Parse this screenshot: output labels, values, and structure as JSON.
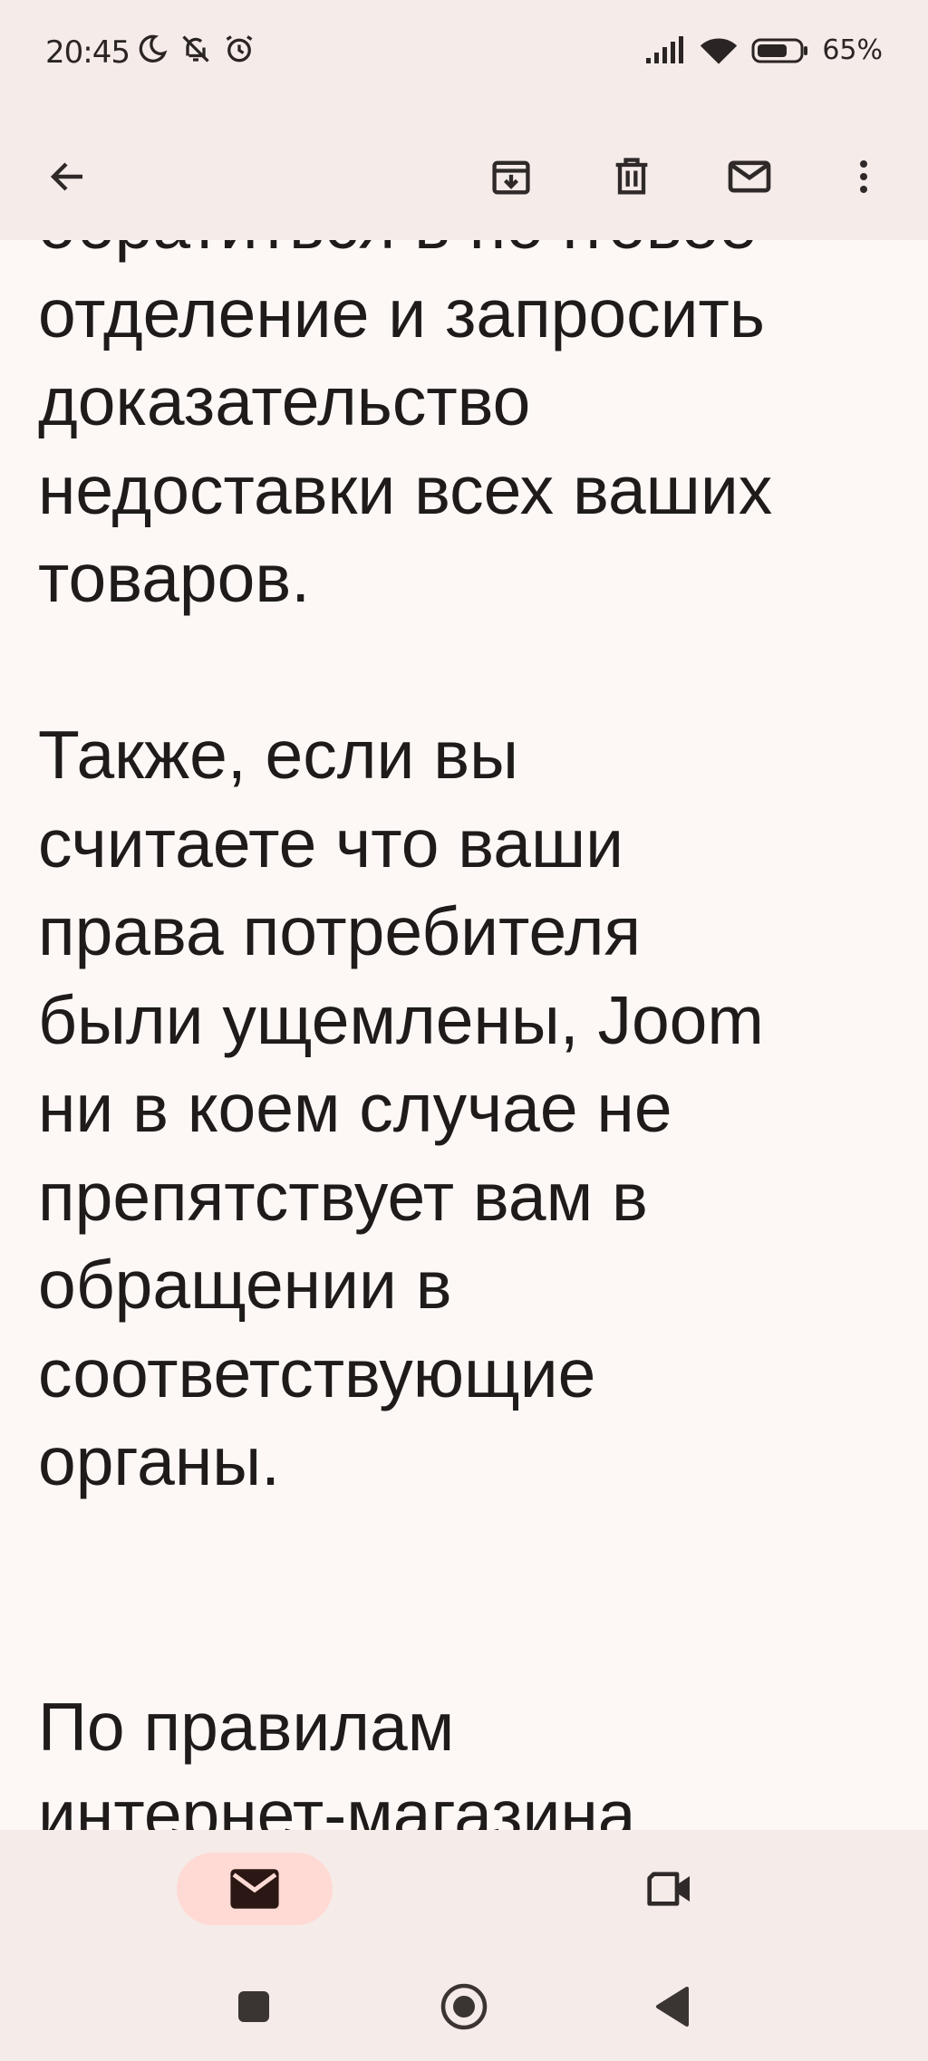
{
  "status_bar": {
    "time": "20:45",
    "left_icons": [
      "moon-icon",
      "bell-off-icon",
      "alarm-icon"
    ],
    "right_icons": [
      "signal-icon",
      "wifi-icon",
      "battery-icon"
    ],
    "battery_percent": "65%"
  },
  "app_bar": {
    "actions": [
      "back-arrow-icon",
      "archive-icon",
      "delete-icon",
      "mark-unread-icon",
      "more-vert-icon"
    ]
  },
  "message": {
    "paragraphs": [
      [
        "обратиться в почтовое",
        "отделение и запросить",
        "доказательство",
        "недоставки всех ваших",
        "товаров."
      ],
      [
        "Также, если вы",
        "считаете что ваши",
        "права потребителя",
        "были ущемлены, Joom",
        "ни в коем случае не",
        "препятствует вам в",
        "обращении в",
        "соответствующие",
        "органы."
      ],
      [
        "По правилам",
        "интернет-магазина"
      ]
    ]
  },
  "bottom_nav": {
    "items": [
      "mail-icon",
      "video-camera-icon"
    ],
    "active": "mail-icon"
  },
  "system_nav": {
    "buttons": [
      "recents-square-icon",
      "home-circle-icon",
      "back-triangle-icon"
    ]
  },
  "colors": {
    "bar_background": "#f5ebe8",
    "content_background": "#fdf8f6",
    "text": "#1e1b1a",
    "active_pill": "#ffdad4",
    "icon": "#2f2a29"
  }
}
